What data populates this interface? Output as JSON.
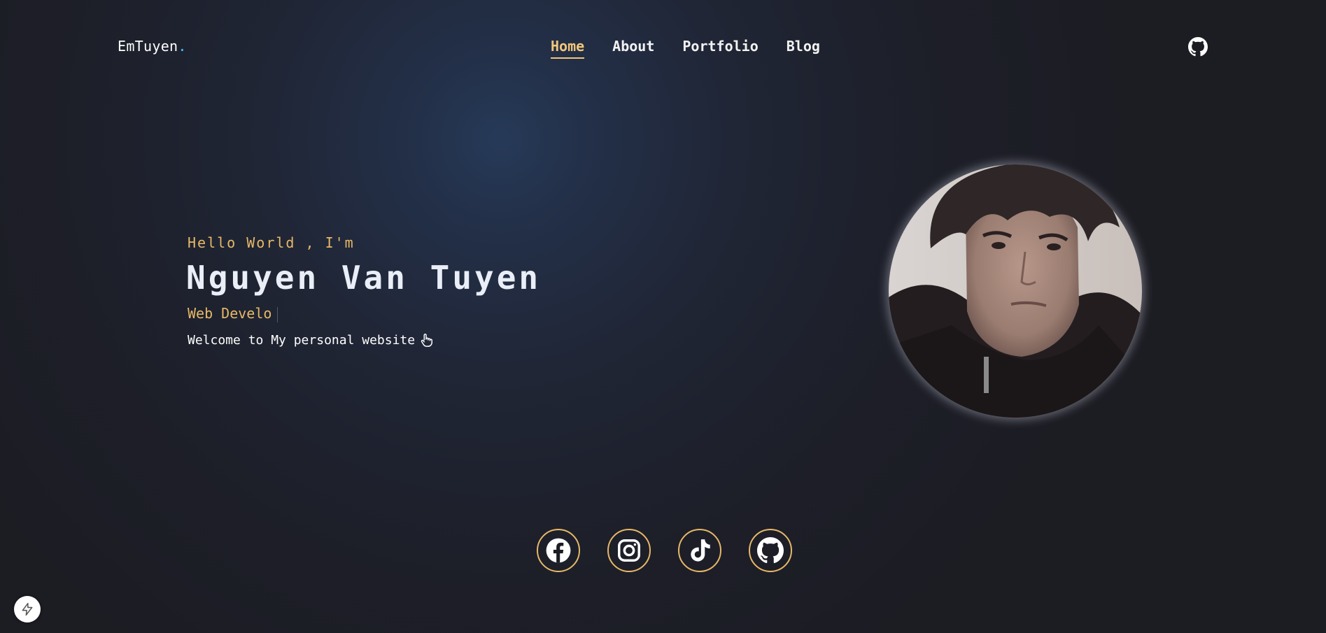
{
  "brand": {
    "name": "EmTuyen",
    "dot": "."
  },
  "nav": {
    "items": [
      {
        "label": "Home",
        "active": true
      },
      {
        "label": "About",
        "active": false
      },
      {
        "label": "Portfolio",
        "active": false
      },
      {
        "label": "Blog",
        "active": false
      }
    ]
  },
  "header": {
    "github_icon": "github-icon"
  },
  "hero": {
    "greeting": "Hello World , I'm",
    "name": "Nguyen Van Tuyen",
    "role_typed": "Web Develo",
    "welcome": "Welcome to My personal website",
    "welcome_icon": "pointing-hand-icon"
  },
  "avatar": {
    "icon": "profile-photo"
  },
  "socials": [
    {
      "icon": "facebook-icon"
    },
    {
      "icon": "instagram-icon"
    },
    {
      "icon": "tiktok-icon"
    },
    {
      "icon": "github-icon"
    }
  ],
  "floating_badge": {
    "icon": "lightning-bolt-icon"
  },
  "colors": {
    "accent": "#e7b867",
    "background": "#1c1c23",
    "logo_dot": "#3ec7ff",
    "text": "#ffffff"
  }
}
